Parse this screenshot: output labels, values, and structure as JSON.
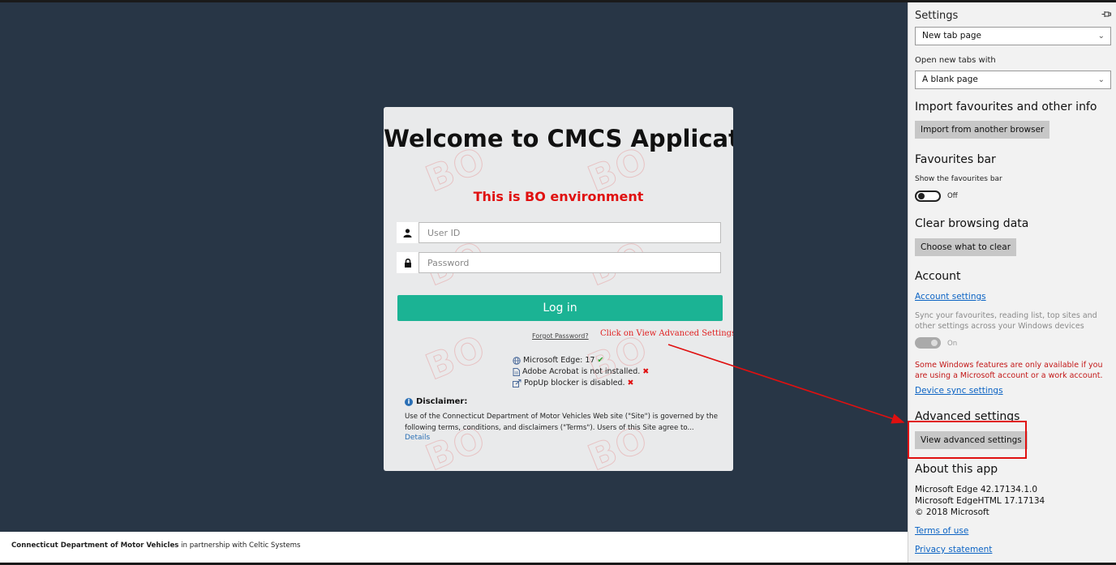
{
  "login": {
    "title": "Welcome to CMCS Application",
    "environment": "This is BO environment",
    "watermark": "BO",
    "userid_placeholder": "User ID",
    "password_placeholder": "Password",
    "login_label": "Log in",
    "forgot_label": "Forgot Password?",
    "checks": [
      {
        "text": "Microsoft Edge: 17",
        "status": "ok",
        "icon": "globe-icon"
      },
      {
        "text": "Adobe Acrobat is not installed.",
        "status": "bad",
        "icon": "document-icon"
      },
      {
        "text": "PopUp blocker is disabled.",
        "status": "bad",
        "icon": "external-link-icon"
      }
    ],
    "disclaimer_heading": "Disclaimer:",
    "disclaimer_text": "Use of the Connecticut Department of Motor Vehicles Web site (\"Site\") is governed by the following terms, conditions, and disclaimers (\"Terms\"). Users of this Site agree to...",
    "details_label": "Details"
  },
  "annotation": {
    "note": "Click on View Advanced Settings",
    "color": "#e01010"
  },
  "footer": {
    "org": "Connecticut Department of Motor Vehicles",
    "partner_text": "in partnership with Celtic Systems"
  },
  "settings": {
    "title": "Settings",
    "pin_icon": "pin-icon",
    "open_with_value": "New tab page",
    "new_tabs_label": "Open new tabs with",
    "new_tabs_value": "A blank page",
    "import_heading": "Import favourites and other info",
    "import_button": "Import from another browser",
    "fav_bar_heading": "Favourites bar",
    "fav_bar_label": "Show the favourites bar",
    "fav_bar_state": "Off",
    "clear_heading": "Clear browsing data",
    "clear_button": "Choose what to clear",
    "account_heading": "Account",
    "account_link": "Account settings",
    "sync_text": "Sync your favourites, reading list, top sites and other settings across your Windows devices",
    "sync_state": "On",
    "warning_text": "Some Windows features are only available if you are using a Microsoft account or a work account.",
    "device_sync_link": "Device sync settings",
    "advanced_heading": "Advanced settings",
    "advanced_button": "View advanced settings",
    "about_heading": "About this app",
    "about_lines": [
      "Microsoft Edge 42.17134.1.0",
      "Microsoft EdgeHTML 17.17134",
      "© 2018 Microsoft"
    ],
    "terms_link": "Terms of use",
    "privacy_link": "Privacy statement"
  },
  "colors": {
    "background": "#283646",
    "accent": "#1bb394",
    "alert": "#e01010",
    "link": "#0b63c4"
  }
}
